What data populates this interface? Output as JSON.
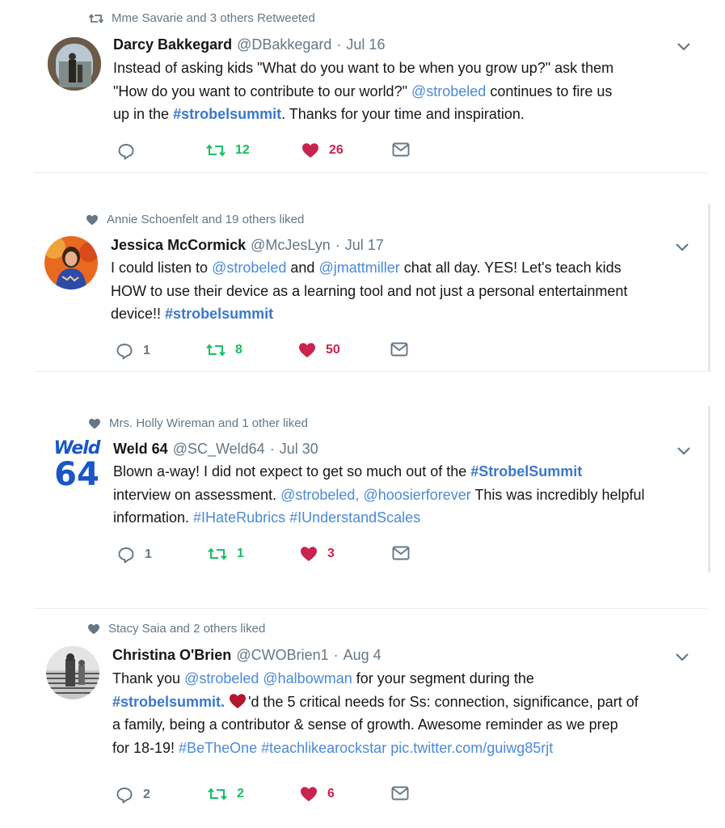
{
  "tweets": [
    {
      "context": "Mme Savarie and 3 others Retweeted",
      "context_icon": "retweet-icon",
      "name": "Darcy Bakkegard",
      "handle": "@DBakkegard",
      "dot": "·",
      "date": "Jul 16",
      "line1_a": "Instead of asking kids \"What do you want to be when you grow up?\" ask them",
      "line2_a": "\"How do you want to contribute to our world?\" ",
      "line2_b": "@strobeled",
      "line2_c": " continues to fire us",
      "line3_a": "up in the ",
      "line3_b": "#strobelsummit",
      "line3_c": ". Thanks for your time and inspiration.",
      "reply_count": "",
      "retweet_count": "12",
      "like_count": "26"
    },
    {
      "context": "Annie Schoenfelt and 19 others liked",
      "context_icon": "heart-icon",
      "name": "Jessica McCormick",
      "handle": "@McJesLyn",
      "dot": "·",
      "date": "Jul 17",
      "line1_a": "I could listen to ",
      "line1_b": "@strobeled",
      "line1_c": " and ",
      "line1_d": "@jmattmiller",
      "line1_e": " chat all day.  YES!  Let's teach kids",
      "line2_a": "HOW to use their device as a learning tool and not just a personal entertainment",
      "line3_a": "device!!  ",
      "line3_b": "#strobelsummit",
      "reply_count": "1",
      "retweet_count": "8",
      "like_count": "50"
    },
    {
      "context": "Mrs. Holly Wireman and 1 other liked",
      "context_icon": "heart-icon",
      "name": "Weld 64",
      "handle": "@SC_Weld64",
      "dot": "·",
      "date": "Jul 30",
      "logo_top": "Weld",
      "logo_bottom": "64",
      "line1_a": "Blown a-way! I did not expect to get so much out of the ",
      "line1_b": "#StrobelSummit",
      "line2_a": "interview on assessment. ",
      "line2_b": "@strobeled, @hoosierforever",
      "line2_c": " This was incredibly helpful",
      "line3_a": "information. ",
      "line3_b": "#IHateRubrics #IUnderstandScales",
      "reply_count": "1",
      "retweet_count": "1",
      "like_count": "3"
    },
    {
      "context": "Stacy Saia and 2 others liked",
      "context_icon": "heart-icon",
      "name": "Christina O'Brien",
      "handle": "@CWOBrien1",
      "dot": "·",
      "date": "Aug 4",
      "line1_a": "Thank you ",
      "line1_b": "@strobeled @halbowman",
      "line1_c": " for your segment during the",
      "line2_a": "#strobelsummit.",
      "line2_b": "'d the 5 critical needs for Ss: connection, significance, part of",
      "line3_a": "a family, being a contributor & sense of growth. Awesome reminder as we prep",
      "line4_a": "for 18-19! ",
      "line4_b": "#BeTheOne #teachlikearockstar pic.twitter.com/guiwg85rjt",
      "reply_count": "2",
      "retweet_count": "2",
      "like_count": "6"
    }
  ],
  "colors": {
    "link": "#4a8ad8",
    "retweet": "#17bf63",
    "like": "#c8244e",
    "muted": "#657786"
  }
}
